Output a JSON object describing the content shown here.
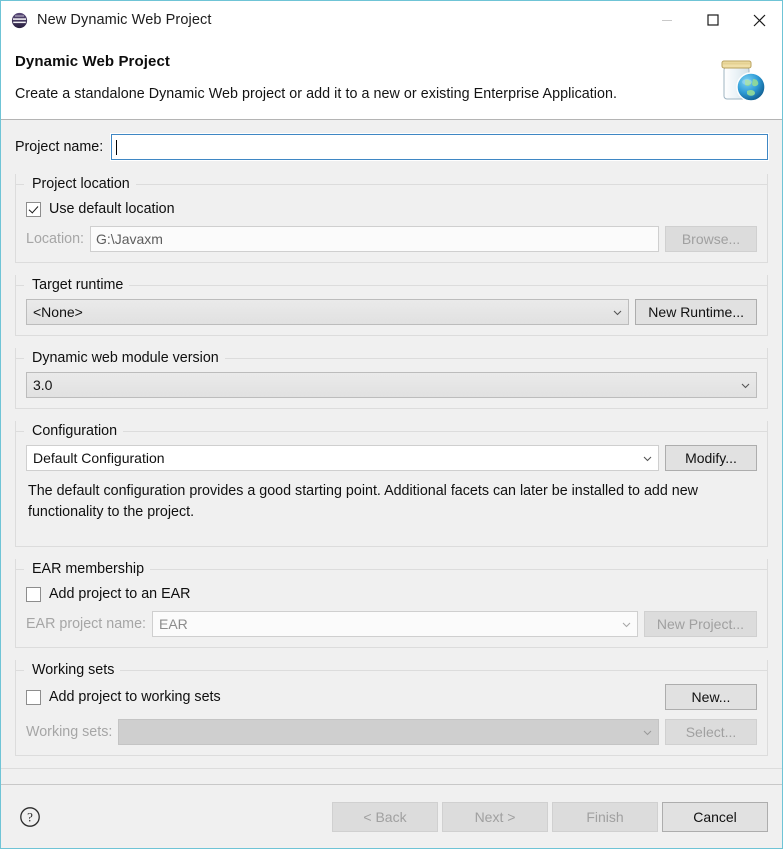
{
  "window": {
    "title": "New Dynamic Web Project",
    "icon": "eclipse-sphere-icon",
    "minimize_label": "Minimize",
    "maximize_label": "Maximize",
    "close_label": "Close"
  },
  "header": {
    "title": "Dynamic Web Project",
    "description": "Create a standalone Dynamic Web project or add it to a new or existing Enterprise Application.",
    "icon": "web-project-jar-globe-icon"
  },
  "form": {
    "project_name": {
      "label": "Project name:",
      "value": "",
      "placeholder": ""
    },
    "project_location": {
      "legend": "Project location",
      "use_default_label": "Use default location",
      "use_default_checked": true,
      "location_label": "Location:",
      "location_value": "G:\\Javaxm",
      "browse_label": "Browse..."
    },
    "target_runtime": {
      "legend": "Target runtime",
      "value": "<None>",
      "new_runtime_label": "New Runtime..."
    },
    "module_version": {
      "legend": "Dynamic web module version",
      "value": "3.0"
    },
    "configuration": {
      "legend": "Configuration",
      "value": "Default Configuration",
      "modify_label": "Modify...",
      "description": "The default configuration provides a good starting point. Additional facets can later be installed to add new functionality to the project."
    },
    "ear_membership": {
      "legend": "EAR membership",
      "add_to_ear_label": "Add project to an EAR",
      "add_to_ear_checked": false,
      "ear_name_label": "EAR project name:",
      "ear_name_value": "EAR",
      "new_project_label": "New Project..."
    },
    "working_sets": {
      "legend": "Working sets",
      "add_to_working_sets_label": "Add project to working sets",
      "add_to_working_sets_checked": false,
      "new_label": "New...",
      "working_sets_label": "Working sets:",
      "working_sets_value": "",
      "select_label": "Select..."
    }
  },
  "footer": {
    "help_icon": "help-question-icon",
    "back_label": "< Back",
    "next_label": "Next >",
    "finish_label": "Finish",
    "cancel_label": "Cancel"
  },
  "colors": {
    "dialog_border": "#6fc4d6",
    "body_background": "#f0f0f0",
    "focus_border": "#3f87c4",
    "disabled_text": "#a0a0a0"
  }
}
